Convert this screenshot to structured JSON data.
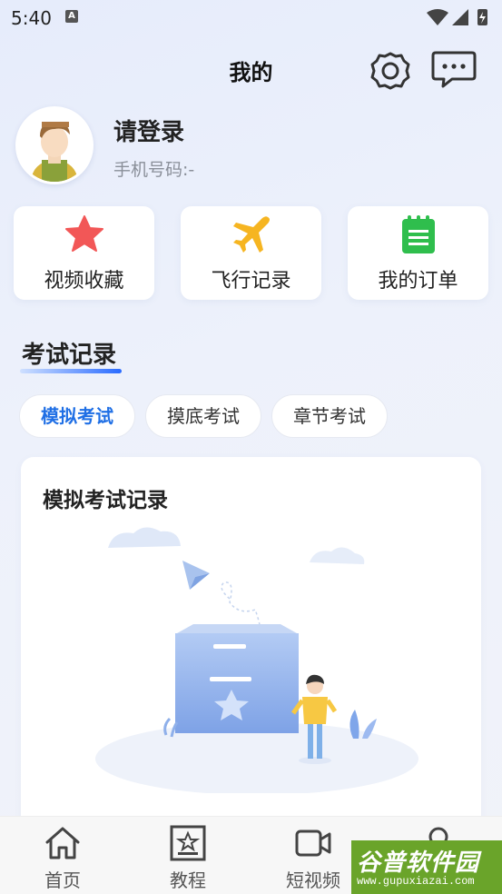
{
  "status_bar": {
    "time": "5:40",
    "notif_icon": "a-icon"
  },
  "header": {
    "title": "我的",
    "settings_icon": "gear-icon",
    "message_icon": "chat-icon"
  },
  "profile": {
    "login_text": "请登录",
    "phone_label": "手机号码:-"
  },
  "quick_actions": [
    {
      "label": "视频收藏",
      "icon": "star-icon",
      "color": "#f25757"
    },
    {
      "label": "飞行记录",
      "icon": "airplane-icon",
      "color": "#f6b521"
    },
    {
      "label": "我的订单",
      "icon": "clipboard-icon",
      "color": "#2fbe4d"
    }
  ],
  "exam_section": {
    "title": "考试记录",
    "tabs": [
      "模拟考试",
      "摸底考试",
      "章节考试"
    ],
    "active_tab": "模拟考试",
    "card_title": "模拟考试记录"
  },
  "bottom_nav": [
    {
      "label": "首页",
      "icon": "home-icon"
    },
    {
      "label": "教程",
      "icon": "tutorial-icon"
    },
    {
      "label": "短视频",
      "icon": "video-icon"
    },
    {
      "label": "",
      "icon": "profile-icon"
    }
  ],
  "watermark": {
    "main": "谷普软件园",
    "url": "www.gupuxiazai.com"
  },
  "colors": {
    "accent": "#1f6fe5",
    "nav_bg": "#f7f7f7",
    "watermark_bg": "#6aa42a"
  }
}
